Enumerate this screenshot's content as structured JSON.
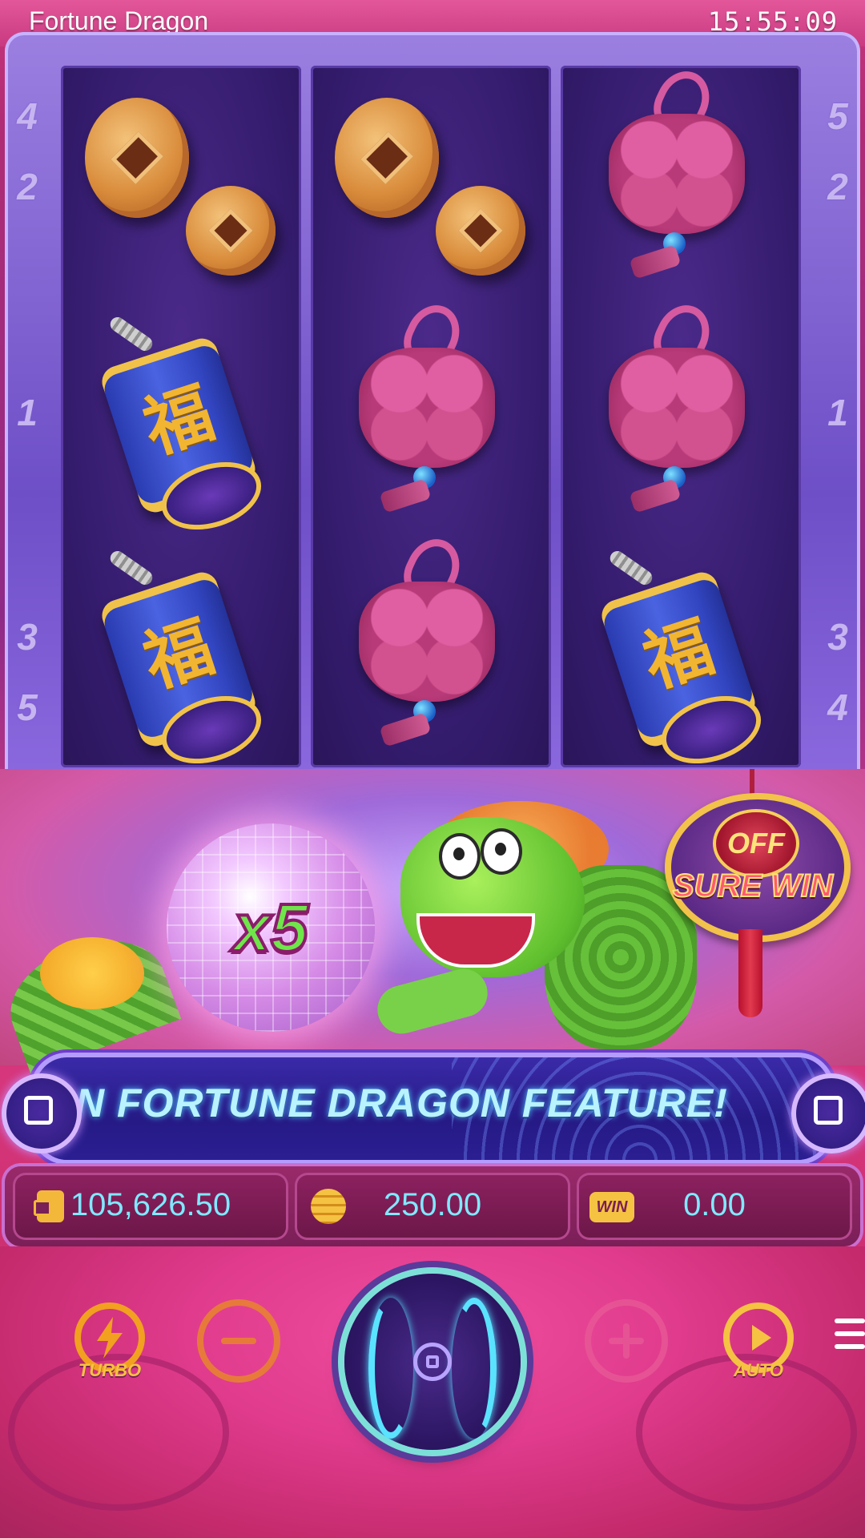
{
  "status_bar": {
    "game_title": "Fortune Dragon",
    "time": "15:55:09"
  },
  "paylines": {
    "left": [
      "4",
      "2",
      "1",
      "3",
      "5"
    ],
    "right": [
      "5",
      "2",
      "1",
      "3",
      "4"
    ]
  },
  "reels": [
    [
      "coins",
      "firecracker",
      "firecracker"
    ],
    [
      "coins",
      "chinese-knot",
      "chinese-knot"
    ],
    [
      "chinese-knot",
      "chinese-knot",
      "firecracker"
    ]
  ],
  "firecracker_glyph": "福",
  "feature": {
    "multiplier": "x5",
    "sure_win_state": "OFF",
    "sure_win_label": "SURE WIN"
  },
  "ticker": {
    "text": "N FORTUNE DRAGON FEATURE!"
  },
  "info": {
    "balance": "105,626.50",
    "bet": "250.00",
    "win": "0.00",
    "win_icon_label": "WIN"
  },
  "controls": {
    "turbo_label": "TURBO",
    "auto_label": "AUTO"
  },
  "colors": {
    "accent_cyan": "#7fe9ff",
    "gold": "#f5c242",
    "reel_bg": "#331b6b"
  }
}
